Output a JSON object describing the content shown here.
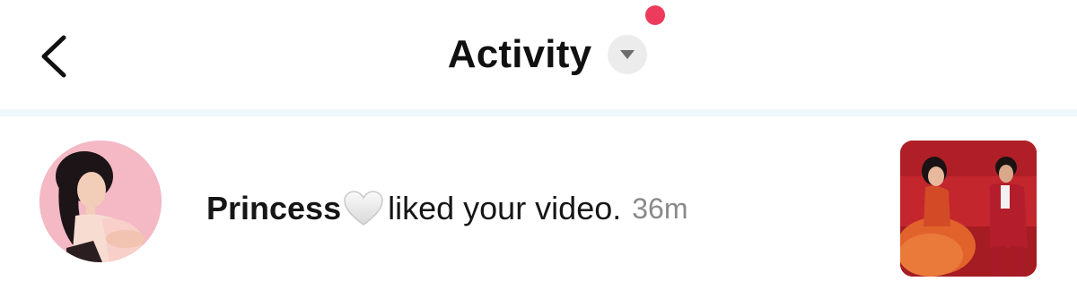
{
  "header": {
    "title": "Activity",
    "icons": {
      "back": "chevron-left-icon",
      "dropdown": "caret-down-icon"
    },
    "notification_dot_color": "#ec3b5c"
  },
  "activity_items": [
    {
      "username": "Princess",
      "emoji": "white-heart",
      "action": "liked your video.",
      "time": "36m"
    }
  ],
  "colors": {
    "text_primary": "#161616",
    "text_secondary": "#8a8a8a",
    "divider": "#eef7fa"
  }
}
